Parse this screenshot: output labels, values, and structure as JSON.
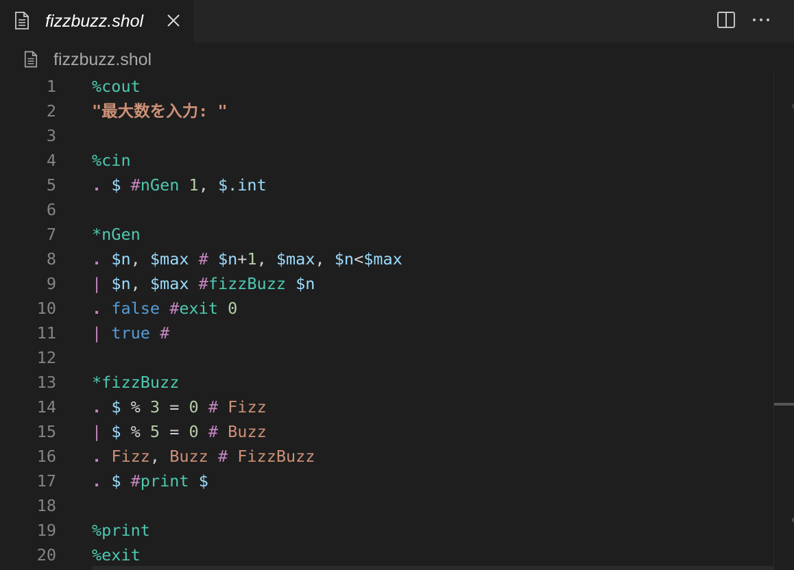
{
  "tab": {
    "title": "fizzbuzz.shol",
    "icon": "file-icon",
    "close_icon": "close-icon"
  },
  "toolbar": {
    "split_icon": "split-editor-icon",
    "more_icon": "more-actions-icon"
  },
  "breadcrumb": {
    "file": "fizzbuzz.shol",
    "icon": "file-icon"
  },
  "colors": {
    "background": "#1e1e1e",
    "tabbar": "#252526",
    "section": "#4ec9b0",
    "string": "#ce9178",
    "operator": "#c586c0",
    "variable": "#9cdcfe",
    "number": "#b5cea8",
    "keyword": "#569cd6",
    "line_number": "#858585"
  },
  "editor": {
    "lines": [
      {
        "n": "1",
        "tokens": [
          [
            "t-sec sig",
            "%"
          ],
          [
            "t-sec",
            "cout"
          ]
        ]
      },
      {
        "n": "2",
        "tokens": [
          [
            "t-str",
            "\"最大数を入力: \""
          ]
        ]
      },
      {
        "n": "3",
        "tokens": []
      },
      {
        "n": "4",
        "tokens": [
          [
            "t-sec sig",
            "%"
          ],
          [
            "t-sec",
            "cin"
          ]
        ]
      },
      {
        "n": "5",
        "tokens": [
          [
            "t-dot",
            "."
          ],
          [
            "t-plain",
            " "
          ],
          [
            "t-var",
            "$"
          ],
          [
            "t-plain",
            " "
          ],
          [
            "t-hash",
            "#"
          ],
          [
            "t-label",
            "nGen"
          ],
          [
            "t-plain",
            " "
          ],
          [
            "t-num",
            "1"
          ],
          [
            "t-plain",
            ", "
          ],
          [
            "t-var",
            "$.int"
          ]
        ]
      },
      {
        "n": "6",
        "tokens": []
      },
      {
        "n": "7",
        "tokens": [
          [
            "t-sec sig",
            "*"
          ],
          [
            "t-sec",
            "nGen"
          ]
        ]
      },
      {
        "n": "8",
        "tokens": [
          [
            "t-dot",
            "."
          ],
          [
            "t-plain",
            " "
          ],
          [
            "t-var",
            "$n"
          ],
          [
            "t-plain",
            ", "
          ],
          [
            "t-var",
            "$max"
          ],
          [
            "t-plain",
            " "
          ],
          [
            "t-hash",
            "#"
          ],
          [
            "t-plain",
            " "
          ],
          [
            "t-var",
            "$n"
          ],
          [
            "t-plain",
            "+"
          ],
          [
            "t-num",
            "1"
          ],
          [
            "t-plain",
            ", "
          ],
          [
            "t-var",
            "$max"
          ],
          [
            "t-plain",
            ", "
          ],
          [
            "t-var",
            "$n"
          ],
          [
            "t-plain",
            "<"
          ],
          [
            "t-var",
            "$max"
          ]
        ]
      },
      {
        "n": "9",
        "tokens": [
          [
            "t-pipe",
            "|"
          ],
          [
            "t-plain",
            " "
          ],
          [
            "t-var",
            "$n"
          ],
          [
            "t-plain",
            ", "
          ],
          [
            "t-var",
            "$max"
          ],
          [
            "t-plain",
            " "
          ],
          [
            "t-hash",
            "#"
          ],
          [
            "t-label",
            "fizzBuzz"
          ],
          [
            "t-plain",
            " "
          ],
          [
            "t-var",
            "$n"
          ]
        ]
      },
      {
        "n": "10",
        "tokens": [
          [
            "t-dot",
            "."
          ],
          [
            "t-plain",
            " "
          ],
          [
            "t-kw",
            "false"
          ],
          [
            "t-plain",
            " "
          ],
          [
            "t-hash",
            "#"
          ],
          [
            "t-label",
            "exit"
          ],
          [
            "t-plain",
            " "
          ],
          [
            "t-num",
            "0"
          ]
        ]
      },
      {
        "n": "11",
        "tokens": [
          [
            "t-pipe",
            "|"
          ],
          [
            "t-plain",
            " "
          ],
          [
            "t-kw",
            "true"
          ],
          [
            "t-plain",
            " "
          ],
          [
            "t-hash",
            "#"
          ]
        ]
      },
      {
        "n": "12",
        "tokens": []
      },
      {
        "n": "13",
        "tokens": [
          [
            "t-sec sig",
            "*"
          ],
          [
            "t-sec",
            "fizzBuzz"
          ]
        ]
      },
      {
        "n": "14",
        "tokens": [
          [
            "t-dot",
            "."
          ],
          [
            "t-plain",
            " "
          ],
          [
            "t-var",
            "$"
          ],
          [
            "t-plain",
            " % "
          ],
          [
            "t-num",
            "3"
          ],
          [
            "t-plain",
            " = "
          ],
          [
            "t-num",
            "0"
          ],
          [
            "t-plain",
            " "
          ],
          [
            "t-hash",
            "#"
          ],
          [
            "t-plain",
            " "
          ],
          [
            "t-word",
            "Fizz"
          ]
        ]
      },
      {
        "n": "15",
        "tokens": [
          [
            "t-pipe",
            "|"
          ],
          [
            "t-plain",
            " "
          ],
          [
            "t-var",
            "$"
          ],
          [
            "t-plain",
            " % "
          ],
          [
            "t-num",
            "5"
          ],
          [
            "t-plain",
            " = "
          ],
          [
            "t-num",
            "0"
          ],
          [
            "t-plain",
            " "
          ],
          [
            "t-hash",
            "#"
          ],
          [
            "t-plain",
            " "
          ],
          [
            "t-word",
            "Buzz"
          ]
        ]
      },
      {
        "n": "16",
        "tokens": [
          [
            "t-dot",
            "."
          ],
          [
            "t-plain",
            " "
          ],
          [
            "t-word",
            "Fizz"
          ],
          [
            "t-plain",
            ", "
          ],
          [
            "t-word",
            "Buzz"
          ],
          [
            "t-plain",
            " "
          ],
          [
            "t-hash",
            "#"
          ],
          [
            "t-plain",
            " "
          ],
          [
            "t-word",
            "FizzBuzz"
          ]
        ]
      },
      {
        "n": "17",
        "tokens": [
          [
            "t-dot",
            "."
          ],
          [
            "t-plain",
            " "
          ],
          [
            "t-var",
            "$"
          ],
          [
            "t-plain",
            " "
          ],
          [
            "t-hash",
            "#"
          ],
          [
            "t-label",
            "print"
          ],
          [
            "t-plain",
            " "
          ],
          [
            "t-var",
            "$"
          ]
        ]
      },
      {
        "n": "18",
        "tokens": []
      },
      {
        "n": "19",
        "tokens": [
          [
            "t-sec sig",
            "%"
          ],
          [
            "t-sec",
            "print"
          ]
        ]
      },
      {
        "n": "20",
        "tokens": [
          [
            "t-sec sig",
            "%"
          ],
          [
            "t-sec",
            "exit"
          ]
        ]
      }
    ]
  }
}
